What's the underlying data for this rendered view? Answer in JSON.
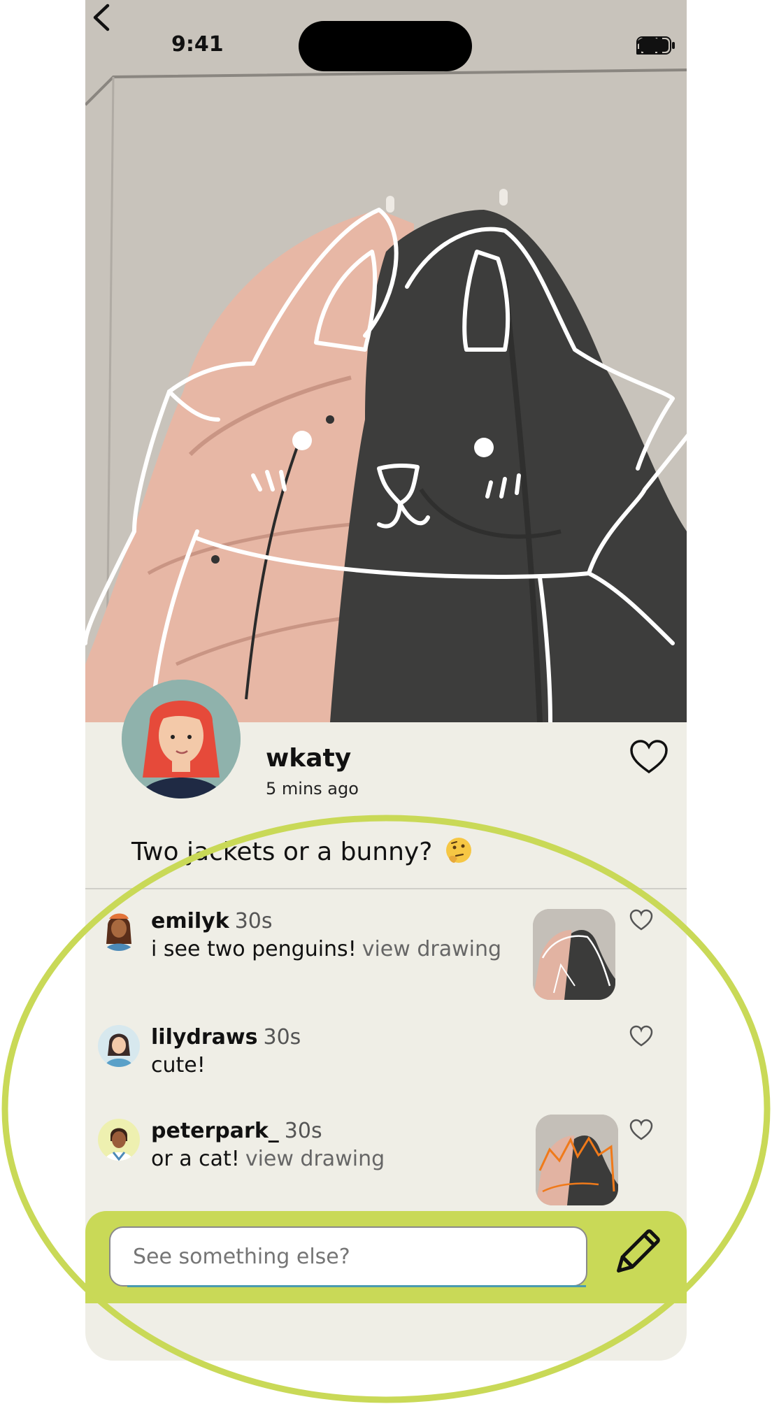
{
  "status_bar": {
    "time": "9:41"
  },
  "post": {
    "username": "wkaty",
    "time_ago": "5 mins ago",
    "caption": "Two jackets or a bunny?"
  },
  "comments": [
    {
      "username": "emilyk",
      "time": "30s",
      "text": "i see two penguins!",
      "link": "view drawing",
      "has_drawing": true
    },
    {
      "username": "lilydraws",
      "time": "30s",
      "text": "cute!",
      "link": "",
      "has_drawing": false
    },
    {
      "username": "peterpark_",
      "time": "30s",
      "text": "or a cat!",
      "link": "view drawing",
      "has_drawing": true
    }
  ],
  "input": {
    "placeholder": "See something else?"
  },
  "colors": {
    "accent": "#c9d957",
    "background": "#efeee6",
    "highlight": "#c9d957"
  },
  "icons": [
    "back-icon",
    "heart-icon",
    "pencil-icon",
    "signal-icon",
    "wifi-icon",
    "battery-icon"
  ]
}
